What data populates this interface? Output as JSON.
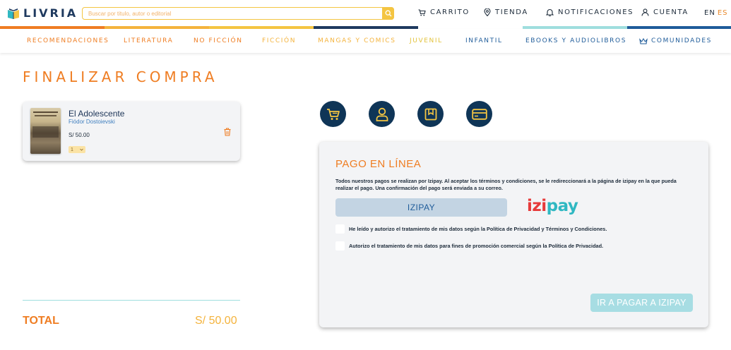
{
  "header": {
    "logo_text": "LIVRIA",
    "search_placeholder": "Buscar por titulo, autor o editorial",
    "nav": {
      "cart": "CARRITO",
      "store": "TIENDA",
      "notifications": "NOTIFICACIONES",
      "account": "CUENTA"
    },
    "lang": {
      "en": "EN",
      "es": "ES"
    }
  },
  "stripe_colors": [
    "#ef7d22",
    "#f4c542",
    "#1f3a5f",
    "#9fdede",
    "#1f5c9a"
  ],
  "categories": [
    {
      "label": "RECOMENDACIONES",
      "color": "#ef7d22"
    },
    {
      "label": "LITERATURA",
      "color": "#ef7d22"
    },
    {
      "label": "NO FICCIÓN",
      "color": "#ef7d22"
    },
    {
      "label": "FICCIÓN",
      "color": "#f4b33c"
    },
    {
      "label": "MANGAS Y COMICS",
      "color": "#f4b33c"
    },
    {
      "label": "JUVENIL",
      "color": "#e2c23a"
    },
    {
      "label": "INFANTIL",
      "color": "#1f5c9a"
    },
    {
      "label": "EBOOKS Y AUDIOLIBROS",
      "color": "#1f5c9a"
    },
    {
      "label": "COMUNIDADES",
      "color": "#1f5c9a"
    }
  ],
  "page": {
    "title": "FINALIZAR COMPRA"
  },
  "cart": {
    "items": [
      {
        "title": "El Adolescente",
        "author": "Fiódor Dostoievski",
        "price": "S/ 50.00",
        "qty": "1"
      }
    ],
    "total_label": "TOTAL",
    "total_value": "S/ 50.00"
  },
  "payment": {
    "title": "PAGO EN LÍNEA",
    "description": "Todos nuestros pagos se realizan por Izipay. Al aceptar los términos y condiciones, se le redireccionará a la página de izipay en la que pueda realizar el pago. Una confirmación del pago será enviada a su correo.",
    "method_label": "IZIPAY",
    "logo": {
      "part1": "izi",
      "part2": "pay"
    },
    "consents": [
      "He leído y autorizo el tratamiento de mis datos según la Política de Privacidad y Términos y Condiciones.",
      "Autorizo el tratamiento de mis datos para fines de promoción comercial según la Política de Privacidad."
    ],
    "submit_label": "IR A PAGAR A IZIPAY"
  },
  "colors": {
    "accent_orange": "#ef7d22",
    "accent_yellow": "#f4c542",
    "navy": "#0f3557",
    "teal": "#9fdede"
  }
}
